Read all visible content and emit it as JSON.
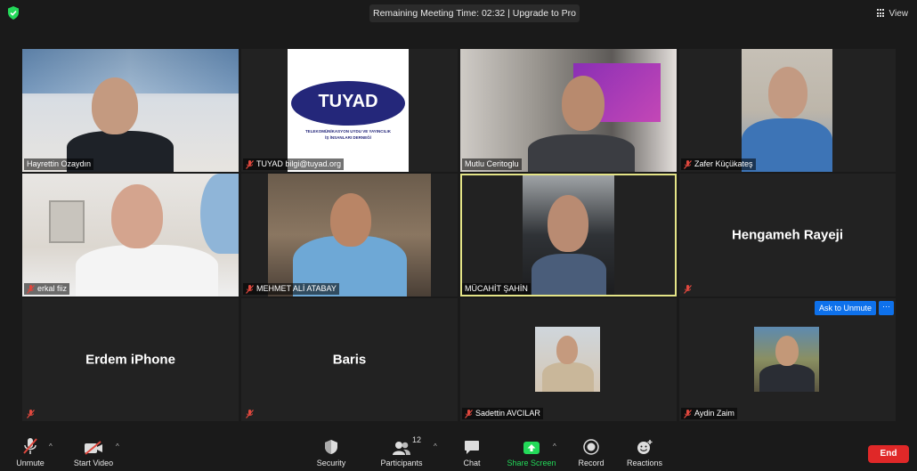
{
  "topbar": {
    "timer_text": "Remaining Meeting Time: 02:32 | Upgrade to Pro",
    "view_label": "View"
  },
  "tiles": [
    {
      "name": "Hayrettin Ozaydın",
      "muted": false
    },
    {
      "name": "TUYAD bilgi@tuyad.org",
      "muted": true
    },
    {
      "name": "Mutlu Ceritoglu",
      "muted": false
    },
    {
      "name": "Zafer Küçükateş",
      "muted": true
    },
    {
      "name": "erkal fiiz",
      "muted": true
    },
    {
      "name": "MEHMET ALİ ATABAY",
      "muted": true
    },
    {
      "name": "MÜCAHİT ŞAHİN",
      "muted": false,
      "active": true
    },
    {
      "name": "Hengameh Rayeji",
      "muted": true
    },
    {
      "name": "Erdem iPhone",
      "muted": true
    },
    {
      "name": "Baris",
      "muted": true
    },
    {
      "name": "Sadettin AVCILAR",
      "muted": true
    },
    {
      "name": "Aydin Zaim",
      "muted": true
    }
  ],
  "logo": {
    "brand": "TUYAD",
    "line1": "TELEKOMÜNİKASYON UYDU VE YAYINCILIK",
    "line2": "İŞ İNSANLARI DERNEĞİ"
  },
  "ask_to_unmute": "Ask to Unmute",
  "more_label": "···",
  "toolbar": {
    "unmute": "Unmute",
    "start_video": "Start Video",
    "security": "Security",
    "participants": "Participants",
    "participants_count": "12",
    "chat": "Chat",
    "share_screen": "Share Screen",
    "record": "Record",
    "reactions": "Reactions",
    "end": "End"
  },
  "colors": {
    "active_border": "#e4e487",
    "share_green": "#23d959",
    "end_red": "#e02828",
    "ask_blue": "#0e71eb",
    "mute_red": "#e0483e"
  }
}
